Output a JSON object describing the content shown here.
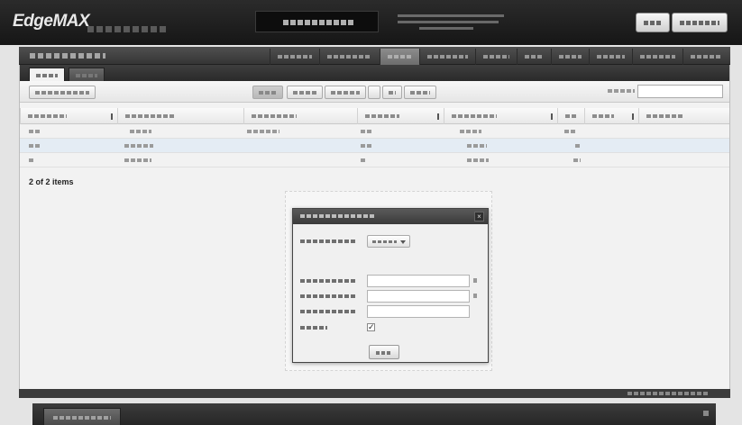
{
  "header": {
    "logo_text": "EdgeMAX",
    "logo_subtitle": "",
    "status_text": "",
    "readouts": [
      "",
      "",
      ""
    ],
    "buttons": [
      {
        "label": ""
      },
      {
        "label": ""
      }
    ]
  },
  "nav": {
    "breadcrumb": "",
    "tabs": [
      {
        "label": "",
        "active": false
      },
      {
        "label": "",
        "active": false
      },
      {
        "label": "",
        "active": true
      },
      {
        "label": "",
        "active": false
      },
      {
        "label": "",
        "active": false
      },
      {
        "label": "",
        "active": false
      },
      {
        "label": "",
        "active": false
      },
      {
        "label": "",
        "active": false
      },
      {
        "label": "",
        "active": false
      },
      {
        "label": "",
        "active": false
      }
    ]
  },
  "subtabs": [
    {
      "label": "",
      "active": true
    },
    {
      "label": "",
      "active": false
    }
  ],
  "toolbar": {
    "add_label": "",
    "buttons": [
      "",
      "",
      "",
      "",
      "",
      ""
    ],
    "search_label": "",
    "search_value": ""
  },
  "table": {
    "columns": [
      "",
      "",
      "",
      "",
      "",
      "",
      "",
      ""
    ],
    "rows": [
      {
        "cells": [
          "",
          "",
          "",
          "",
          "",
          "",
          ""
        ],
        "selected": false
      },
      {
        "cells": [
          "",
          "",
          "",
          "",
          "",
          "",
          ""
        ],
        "selected": true
      },
      {
        "cells": [
          "",
          "",
          "",
          "",
          "",
          "",
          ""
        ],
        "selected": false
      }
    ],
    "item_count": "2 of 2 items"
  },
  "dialog": {
    "title": "",
    "close_glyph": "×",
    "type_label": "",
    "type_value": "",
    "fields": [
      {
        "label": "",
        "value": ""
      },
      {
        "label": "",
        "value": ""
      },
      {
        "label": "",
        "value": ""
      }
    ],
    "enabled_label": "",
    "enabled_checked": true,
    "checkbox_glyph": "✓",
    "save_label": ""
  },
  "footer": {
    "tab_label": "",
    "status_text": ""
  }
}
